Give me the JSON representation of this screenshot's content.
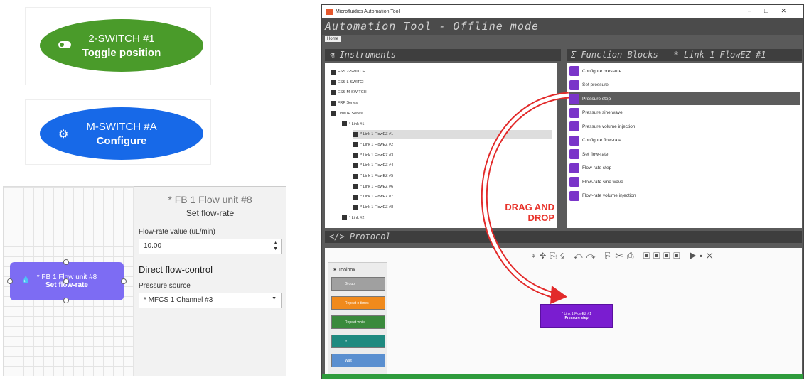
{
  "two_switch": {
    "line1": "2-SWITCH #1",
    "line2": "Toggle position",
    "color": "#4a9b2a",
    "icon": "toggle-icon"
  },
  "m_switch": {
    "line1": "M-SWITCH #A",
    "line2": "Configure",
    "color": "#1769e8",
    "icon": "gear-icon"
  },
  "fb_node": {
    "line1": "* FB 1 Flow unit #8",
    "line2": "Set flow-rate",
    "icon": "drop-icon"
  },
  "props": {
    "title": "* FB 1 Flow unit #8",
    "subtitle": "Set flow-rate",
    "rate_label": "Flow-rate value (uL/min)",
    "rate_value": "10.00",
    "section": "Direct flow-control",
    "source_label": "Pressure source",
    "source_value": "* MFCS 1 Channel #3"
  },
  "window": {
    "title": "Microfluidics Automation Tool",
    "app_title": "Automation Tool - Offline mode",
    "home_tab": "Home",
    "instruments_header": "Instruments",
    "function_blocks_header": "Function Blocks  - * Link 1 FlowEZ #1",
    "protocol_header": "Protocol",
    "instruments": [
      "ESS 2-SWITCH",
      "ESS L-SWITCH",
      "ESS M-SWITCH",
      "FRP Series",
      "LineUP Series",
      "* Link #1",
      "* Link 1 FlowEZ #1",
      "* Link 1 FlowEZ #2",
      "* Link 1 FlowEZ #3",
      "* Link 1 FlowEZ #4",
      "* Link 1 FlowEZ #5",
      "* Link 1 FlowEZ #6",
      "* Link 1 FlowEZ #7",
      "* Link 1 FlowEZ #8",
      "* Link #2"
    ],
    "function_blocks": [
      "Configure pressure",
      "Set pressure",
      "Pressure step",
      "Pressure sine wave",
      "Pressure volume injection",
      "Configure flow-rate",
      "Set flow-rate",
      "Flow-rate step",
      "Flow-rate sine wave",
      "Flow-rate volume injection"
    ],
    "drag_drop": "DRAG AND\nDROP",
    "toolbox_title": "Toolbox",
    "toolbox_items": [
      "Group",
      "Repeat n times",
      "Repeat while",
      "If",
      "Wait"
    ],
    "protocol_node": {
      "line1": "* Link 1 FlowEZ #1",
      "line2": "Pressure step"
    }
  }
}
